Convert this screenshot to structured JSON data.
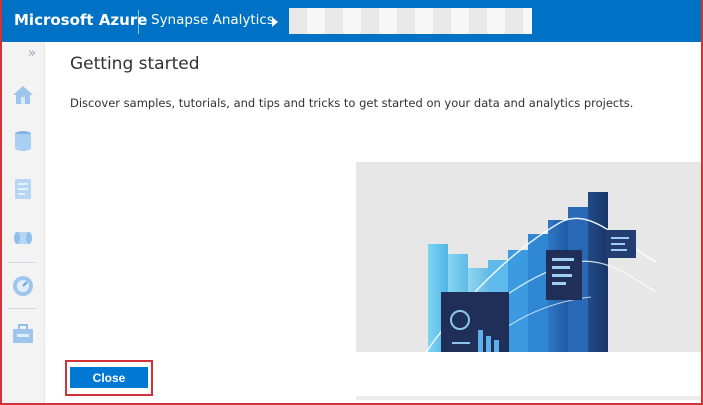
{
  "topbar": {
    "brand": "Microsoft Azure",
    "service": "Synapse Analytics",
    "breadcrumb_caret_icon": "caret-right-icon"
  },
  "sidebar": {
    "expand_icon": "double-chevron-right-icon",
    "items": [
      {
        "icon": "home-icon"
      },
      {
        "icon": "database-icon"
      },
      {
        "icon": "document-icon"
      },
      {
        "icon": "pipeline-icon"
      },
      {
        "icon": "monitor-icon"
      },
      {
        "icon": "manage-toolbox-icon"
      }
    ]
  },
  "main": {
    "title": "Getting started",
    "subtitle": "Discover samples, tutorials, and tips and tricks to get started on your data and analytics projects."
  },
  "footer": {
    "close_label": "Close"
  },
  "colors": {
    "accent": "#0072c6",
    "button": "#0078d4",
    "highlight": "#d13438"
  }
}
